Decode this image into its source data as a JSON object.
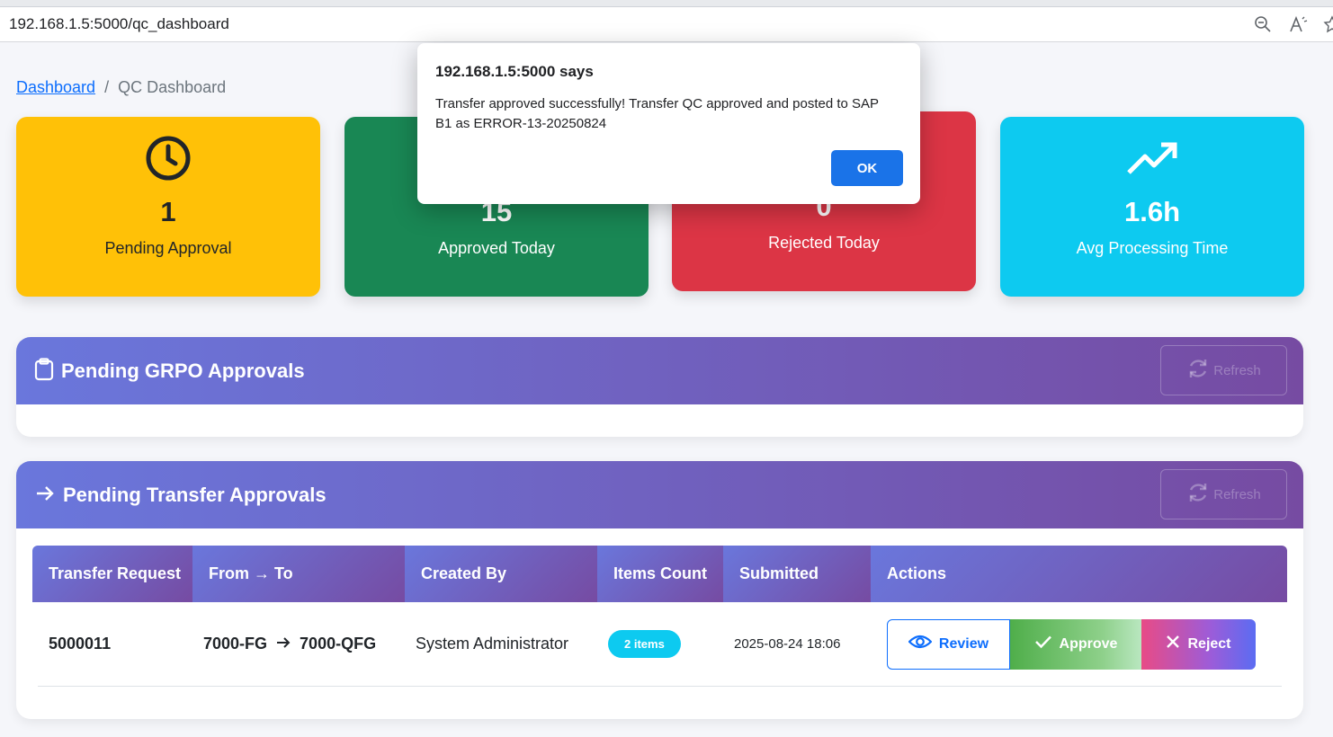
{
  "browser": {
    "url": "192.168.1.5:5000/qc_dashboard",
    "icons": [
      "zoom-out-icon",
      "read-aloud-icon",
      "favorite-star-icon"
    ]
  },
  "breadcrumb": {
    "home": "Dashboard",
    "separator": "/",
    "current": "QC Dashboard"
  },
  "stats": {
    "pending": {
      "value": "1",
      "label": "Pending Approval",
      "icon": "clock-icon",
      "color": "#ffc107"
    },
    "approved": {
      "value": "15",
      "label": "Approved Today",
      "icon": "check-circle-icon",
      "color": "#198754"
    },
    "rejected": {
      "value": "0",
      "label": "Rejected Today",
      "icon": "x-circle-icon",
      "color": "#dc3545"
    },
    "avg": {
      "value": "1.6h",
      "label": "Avg Processing Time",
      "icon": "trending-up-icon",
      "color": "#0dcaf0"
    }
  },
  "grpo_panel": {
    "title": "Pending GRPO Approvals",
    "refresh_label": "Refresh"
  },
  "transfer_panel": {
    "title": "Pending Transfer Approvals",
    "refresh_label": "Refresh",
    "columns": [
      "Transfer Request",
      "From → To",
      "Created By",
      "Items Count",
      "Submitted",
      "Actions"
    ],
    "rows": [
      {
        "request": "5000011",
        "from": "7000-FG",
        "to": "7000-QFG",
        "created_by": "System Administrator",
        "items": "2 items",
        "submitted": "2025-08-24 18:06",
        "review_label": "Review",
        "approve_label": "Approve",
        "reject_label": "Reject"
      }
    ]
  },
  "dialog": {
    "title": "192.168.1.5:5000 says",
    "message": "Transfer approved successfully! Transfer QC approved and posted to SAP B1 as ERROR-13-20250824",
    "ok_label": "OK"
  },
  "colors": {
    "header_gradient_start": "#6a77dc",
    "header_gradient_end": "#764ba2",
    "primary": "#0d6efd"
  }
}
